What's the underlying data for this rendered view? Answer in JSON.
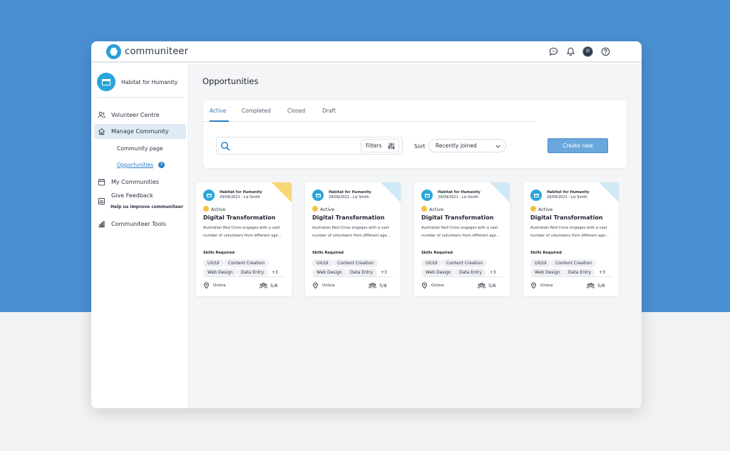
{
  "app": {
    "name": "communiteer"
  },
  "colors": {
    "accent": "#2a7ec6",
    "background_top": "#4a8fd1",
    "create_button": "#6aa7dd",
    "status_active": "#f5c23d",
    "corner_yellow": "#f7d774",
    "corner_blue": "#cfe8f5"
  },
  "header": {
    "icons": [
      "chat-icon",
      "bell-icon",
      "avatar",
      "help-icon"
    ]
  },
  "sidebar": {
    "org_name": "Habitat for Humanity",
    "items": [
      {
        "label": "Volunteer Centre",
        "icon": "users-icon"
      },
      {
        "label": "Manage Community",
        "icon": "home-icon",
        "active": true
      },
      {
        "label": "Community page"
      },
      {
        "label": "Opportunities",
        "badge": "3",
        "active": true
      },
      {
        "label": "My Communities",
        "icon": "calendar-icon"
      },
      {
        "label": "Give Feedback",
        "sublabel": "Help us improve communiteer",
        "icon": "inbox-icon"
      },
      {
        "label": "Communiteer Tools",
        "icon": "chart-icon"
      }
    ]
  },
  "main": {
    "title": "Opportunities",
    "tabs": [
      "Active",
      "Completed",
      "Closed",
      "Draft"
    ],
    "filters_label": "Filters",
    "sort_label": "Sort",
    "sort_value": "Recently joined",
    "create_label": "Create new",
    "cards": [
      {
        "org": "Habitat for Humanity",
        "meta": "29/09/2021 - Liz Smith",
        "status": "Active",
        "title": "Digital Transformation",
        "desc": "Australian Red Cross engages with a vast number of volunteers from different age...",
        "skills_label": "Skills Required",
        "skills": [
          "UX/UI",
          "Content Creation",
          "Web Design",
          "Data Entry"
        ],
        "more": "+3",
        "location": "Online",
        "count": "5/8",
        "corner": "yellow"
      },
      {
        "org": "Habitat for Humanity",
        "meta": "29/09/2021 - Liz Smith",
        "status": "Active",
        "title": "Digital Transformation",
        "desc": "Australian Red Cross engages with a vast number of volunteers from different age...",
        "skills_label": "Skills Required",
        "skills": [
          "UX/UI",
          "Content Creation",
          "Web Design",
          "Data Entry"
        ],
        "more": "+3",
        "location": "Online",
        "count": "5/8",
        "corner": "blue"
      },
      {
        "org": "Habitat for Humanity",
        "meta": "29/09/2021 - Liz Smith",
        "status": "Active",
        "title": "Digital Transformation",
        "desc": "Australian Red Cross engages with a vast number of volunteers from different age...",
        "skills_label": "Skills Required",
        "skills": [
          "UX/UI",
          "Content Creation",
          "Web Design",
          "Data Entry"
        ],
        "more": "+3",
        "location": "Online",
        "count": "5/8",
        "corner": "blue"
      },
      {
        "org": "Habitat for Humanity",
        "meta": "29/09/2021 - Liz Smith",
        "status": "Active",
        "title": "Digital Transformation",
        "desc": "Australian Red Cross engages with a vast number of volunteers from different age...",
        "skills_label": "Skills Required",
        "skills": [
          "UX/UI",
          "Content Creation",
          "Web Design",
          "Data Entry"
        ],
        "more": "+3",
        "location": "Online",
        "count": "5/8",
        "corner": "blue"
      }
    ]
  }
}
